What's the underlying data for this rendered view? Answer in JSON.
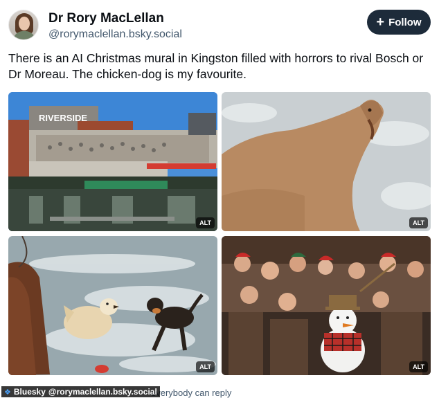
{
  "author": {
    "display_name": "Dr Rory MacLellan",
    "handle": "@rorymaclellan.bsky.social"
  },
  "follow_button": {
    "label": "Follow",
    "icon": "plus-icon"
  },
  "post": {
    "text": "There is an AI Christmas mural in Kingston filled with horrors to rival Bosch or Dr Moreau. The chicken-dog is my favourite."
  },
  "images": [
    {
      "alt_badge": "ALT",
      "sign_text": "RIVERSIDE"
    },
    {
      "alt_badge": "ALT"
    },
    {
      "alt_badge": "ALT"
    },
    {
      "alt_badge": "ALT"
    }
  ],
  "footer": {
    "reply_setting": "everybody can reply",
    "watermark_brand": "Bluesky",
    "watermark_handle": "@rorymaclellan.bsky.social"
  },
  "colors": {
    "follow_bg": "#1d2b3a",
    "handle_text": "#42576c"
  }
}
